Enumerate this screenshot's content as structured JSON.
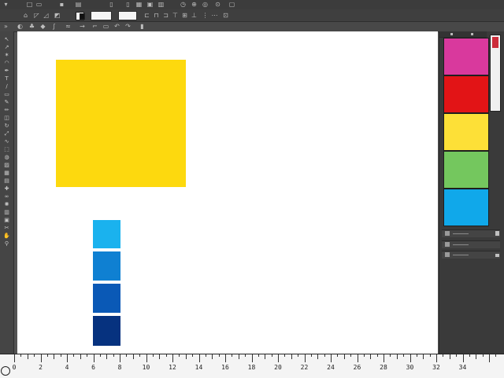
{
  "app": {
    "accent": "#535353"
  },
  "toolbar_icons": [
    "selection-tool-icon",
    "direct-selection-tool-icon",
    "magic-wand-icon",
    "lasso-icon",
    "pen-tool-icon",
    "type-tool-icon",
    "line-tool-icon",
    "rectangle-tool-icon",
    "paintbrush-icon",
    "pencil-icon",
    "eraser-icon",
    "rotate-tool-icon",
    "scale-tool-icon",
    "warp-tool-icon",
    "free-transform-icon",
    "shape-builder-icon",
    "perspective-grid-icon",
    "mesh-tool-icon",
    "gradient-tool-icon",
    "eyedropper-icon",
    "blend-tool-icon",
    "symbol-sprayer-icon",
    "graph-tool-icon",
    "artboard-tool-icon",
    "slice-tool-icon",
    "hand-tool-icon",
    "zoom-tool-icon"
  ],
  "canvas": {
    "shapes": [
      {
        "name": "yellow-square",
        "color": "#fdd90e"
      },
      {
        "name": "cyan-rectangle",
        "color": "#1ab2ee"
      },
      {
        "name": "blue-rectangle",
        "color": "#0f80d2"
      },
      {
        "name": "medium-blue-rectangle",
        "color": "#0a59b6"
      },
      {
        "name": "navy-rectangle",
        "color": "#06327f"
      }
    ]
  },
  "swatches_panel": {
    "swatches": [
      {
        "name": "magenta",
        "color": "#d9399d"
      },
      {
        "name": "red",
        "color": "#e21416"
      },
      {
        "name": "yellow",
        "color": "#fde037"
      },
      {
        "name": "green",
        "color": "#74c75e"
      },
      {
        "name": "cyan",
        "color": "#10a8ea"
      }
    ]
  },
  "ruler": {
    "labels": [
      "0",
      "2",
      "4",
      "6",
      "8",
      "10",
      "12",
      "14",
      "16",
      "18",
      "20",
      "22",
      "24",
      "26",
      "28",
      "30",
      "32",
      "34"
    ]
  }
}
